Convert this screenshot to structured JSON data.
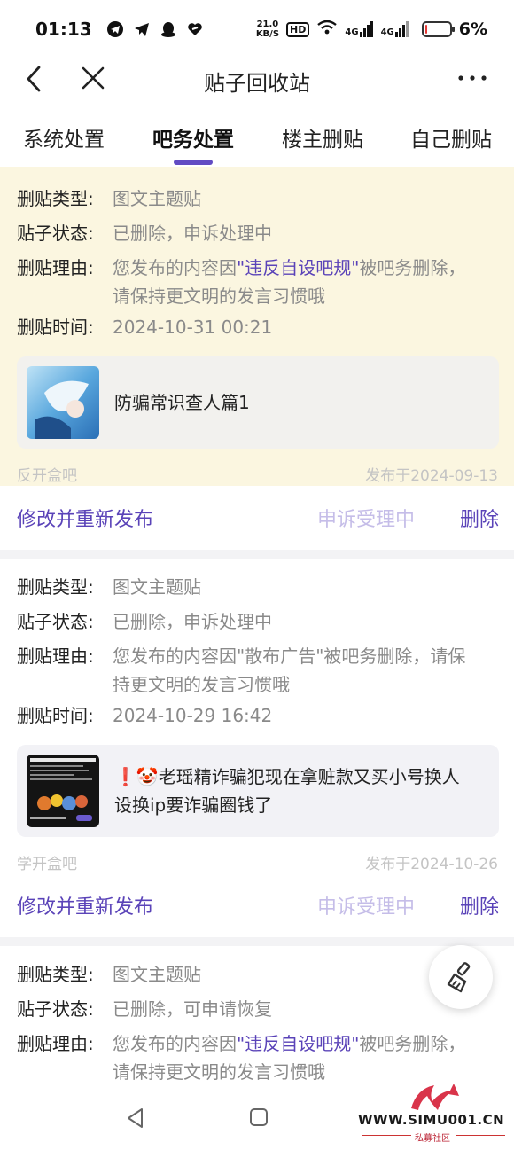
{
  "status_bar": {
    "time": "01:13",
    "icons": [
      "telegram-icon",
      "send-icon",
      "qq-icon",
      "heart-app-icon"
    ],
    "net_speed_value": "21.0",
    "net_speed_unit": "KB/S",
    "hd_label": "HD",
    "signal_label_1": "4G",
    "signal_label_2": "4G",
    "battery_percent": "6%",
    "battery_level": 0.06
  },
  "nav": {
    "title": "贴子回收站"
  },
  "tabs": [
    {
      "label": "系统处置",
      "active": false
    },
    {
      "label": "吧务处置",
      "active": true
    },
    {
      "label": "楼主删贴",
      "active": false
    },
    {
      "label": "自己删贴",
      "active": false
    }
  ],
  "labels": {
    "type": "删贴类型:",
    "status": "贴子状态:",
    "reason": "删贴理由:",
    "time": "删贴时间:"
  },
  "posts": [
    {
      "type": "图文主题贴",
      "status": "已删除，申诉处理中",
      "reason_prefix": "您发布的内容因",
      "reason_highlight": "\"违反自设吧规\"",
      "reason_suffix": "被吧务删除，",
      "reason_line2": "请保持更文明的发言习惯哦",
      "time": "2024-10-31 00:21",
      "title": "防骗常识查人篇1",
      "forum": "反开盒吧",
      "published": "发布于2024-09-13",
      "action_repost": "修改并重新发布",
      "action_appeal": "申诉受理中",
      "action_delete": "删除"
    },
    {
      "type": "图文主题贴",
      "status": "已删除，申诉处理中",
      "reason_line1": "您发布的内容因\"散布广告\"被吧务删除，请保",
      "reason_line2": "持更文明的发言习惯哦",
      "time": "2024-10-29 16:42",
      "title_line1": "❗🤡老瑶精诈骗犯现在拿赃款又买小号换人",
      "title_line2": "设换ip要诈骗圈钱了",
      "forum": "学开盒吧",
      "published": "发布于2024-10-26",
      "action_repost": "修改并重新发布",
      "action_appeal": "申诉受理中",
      "action_delete": "删除"
    },
    {
      "type": "图文主题贴",
      "status": "已删除，可申请恢复",
      "reason_prefix": "您发布的内容因",
      "reason_highlight": "\"违反自设吧规\"",
      "reason_suffix": "被吧务删除，",
      "reason_line2": "请保持更文明的发言习惯哦"
    }
  ],
  "watermark": {
    "text": "WWW.SIMU001.CN",
    "sub": "私募社区"
  },
  "colors": {
    "accent": "#5a43b8",
    "highlight_bg": "#fbf6e0",
    "muted": "#8a8a8a"
  }
}
